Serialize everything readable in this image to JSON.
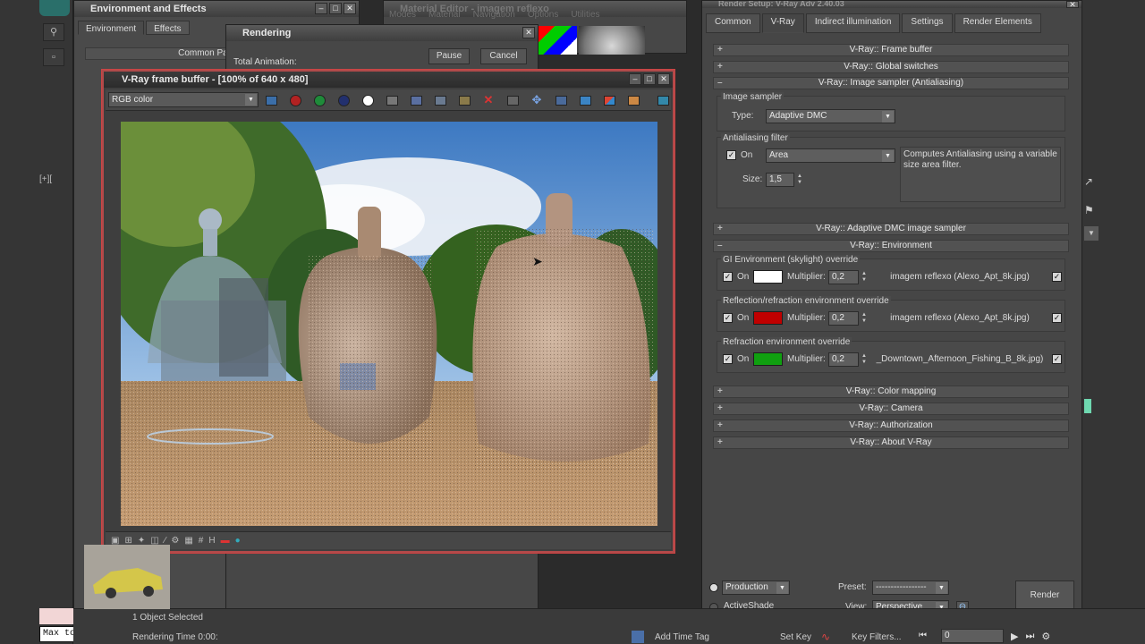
{
  "env_window": {
    "title": "Environment and Effects",
    "tabs": [
      "Environment",
      "Effects"
    ],
    "section": "Common Par"
  },
  "render_window": {
    "title": "Rendering",
    "pause": "Pause",
    "cancel": "Cancel",
    "total_animation": "Total Animation:",
    "rendering_time": "Rendering Time  0:00:"
  },
  "mat_window": {
    "title": "Material Editor - imagem reflexo",
    "menu": [
      "Modes",
      "Material",
      "Navigation",
      "Options",
      "Utilities"
    ]
  },
  "vfb": {
    "title": "V-Ray frame buffer - [100% of 640 x 480]",
    "channel": "RGB color",
    "tool_colors": {
      "red": "#b22222",
      "green": "#1f8b3a",
      "blue": "#22306e",
      "white": "#ffffff"
    }
  },
  "render_setup": {
    "title": "Render Setup: V-Ray Adv 2.40.03",
    "tabs": [
      "Common",
      "V-Ray",
      "Indirect illumination",
      "Settings",
      "Render Elements"
    ],
    "rollouts": {
      "frame_buffer": "V-Ray:: Frame buffer",
      "global_switches": "V-Ray:: Global switches",
      "image_sampler": "V-Ray:: Image sampler (Antialiasing)",
      "adaptive_dmc": "V-Ray:: Adaptive DMC image sampler",
      "environment": "V-Ray:: Environment",
      "color_mapping": "V-Ray:: Color mapping",
      "camera": "V-Ray:: Camera",
      "authorization": "V-Ray:: Authorization",
      "about": "V-Ray:: About V-Ray"
    },
    "image_sampler": {
      "group_label": "Image sampler",
      "type_label": "Type:",
      "type_value": "Adaptive DMC",
      "aa_group": "Antialiasing filter",
      "on_label": "On",
      "filter_value": "Area",
      "size_label": "Size:",
      "size_value": "1,5",
      "description": "Computes Antialiasing using a variable size area filter."
    },
    "environment": {
      "gi": {
        "label": "GI Environment (skylight) override",
        "on": "On",
        "color": "#ffffff",
        "mult_label": "Multiplier:",
        "mult": "0,2",
        "map": "imagem reflexo (Alexo_Apt_8k.jpg)"
      },
      "refl": {
        "label": "Reflection/refraction environment override",
        "on": "On",
        "color": "#c00000",
        "mult_label": "Multiplier:",
        "mult": "0,2",
        "map": "imagem reflexo (Alexo_Apt_8k.jpg)"
      },
      "refr": {
        "label": "Refraction environment override",
        "on": "On",
        "color": "#10a010",
        "mult_label": "Multiplier:",
        "mult": "0,2",
        "map": "_Downtown_Afternoon_Fishing_B_8k.jpg)"
      }
    },
    "footer": {
      "production": "Production",
      "activeshade": "ActiveShade",
      "preset_label": "Preset:",
      "preset_value": "-----------------",
      "view_label": "View:",
      "view_value": "Perspective",
      "render": "Render"
    }
  },
  "status": {
    "selected": "1 Object Selected",
    "script": "Max to Physc",
    "add_time_tag": "Add Time Tag",
    "set_key": "Set Key",
    "key_filters": "Key Filters...",
    "frame": "0"
  }
}
